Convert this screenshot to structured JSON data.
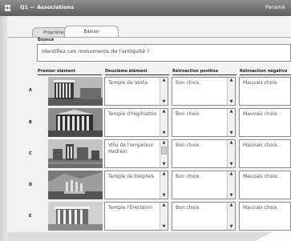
{
  "window": {
    "title": "Q1 — Associations",
    "right_label": "Paramè",
    "icon": "quiz-app-icon"
  },
  "tabs": [
    {
      "label": "Propriétés",
      "active": false
    },
    {
      "label": "Édition",
      "active": true
    }
  ],
  "question": {
    "label": "Énoncé",
    "text": "Identifiez ces monuments de l'antiquité ?"
  },
  "columns": {
    "first": "Premier élément",
    "second": "Deuxième élément",
    "positive": "Rétroaction positive",
    "negative": "Rétroaction négative"
  },
  "rows": [
    {
      "letter": "A",
      "image": "temple-photo",
      "second": "Temple de Vesta",
      "positive": "Bon choix.",
      "negative": "Mauvais choix."
    },
    {
      "letter": "B",
      "image": "temple-photo",
      "second": "Temple d'Hephastos",
      "positive": "Bon choix.",
      "negative": "Mauvais choix."
    },
    {
      "letter": "C",
      "image": "villa-photo",
      "second": "Villa de l'empereur Hadrien",
      "positive": "Bon choix.",
      "negative": "Mauvais choix."
    },
    {
      "letter": "D",
      "image": "ruins-photo",
      "second": "Temple de Delphes",
      "positive": "Bon choix.",
      "negative": "Mauvais choix."
    },
    {
      "letter": "E",
      "image": "temple-photo",
      "second": "Temple l'Érectéion",
      "positive": "Bon choix.",
      "negative": "Mauvais choix."
    }
  ],
  "icons": {
    "scroll_up": "▲",
    "scroll_down": "▼"
  }
}
